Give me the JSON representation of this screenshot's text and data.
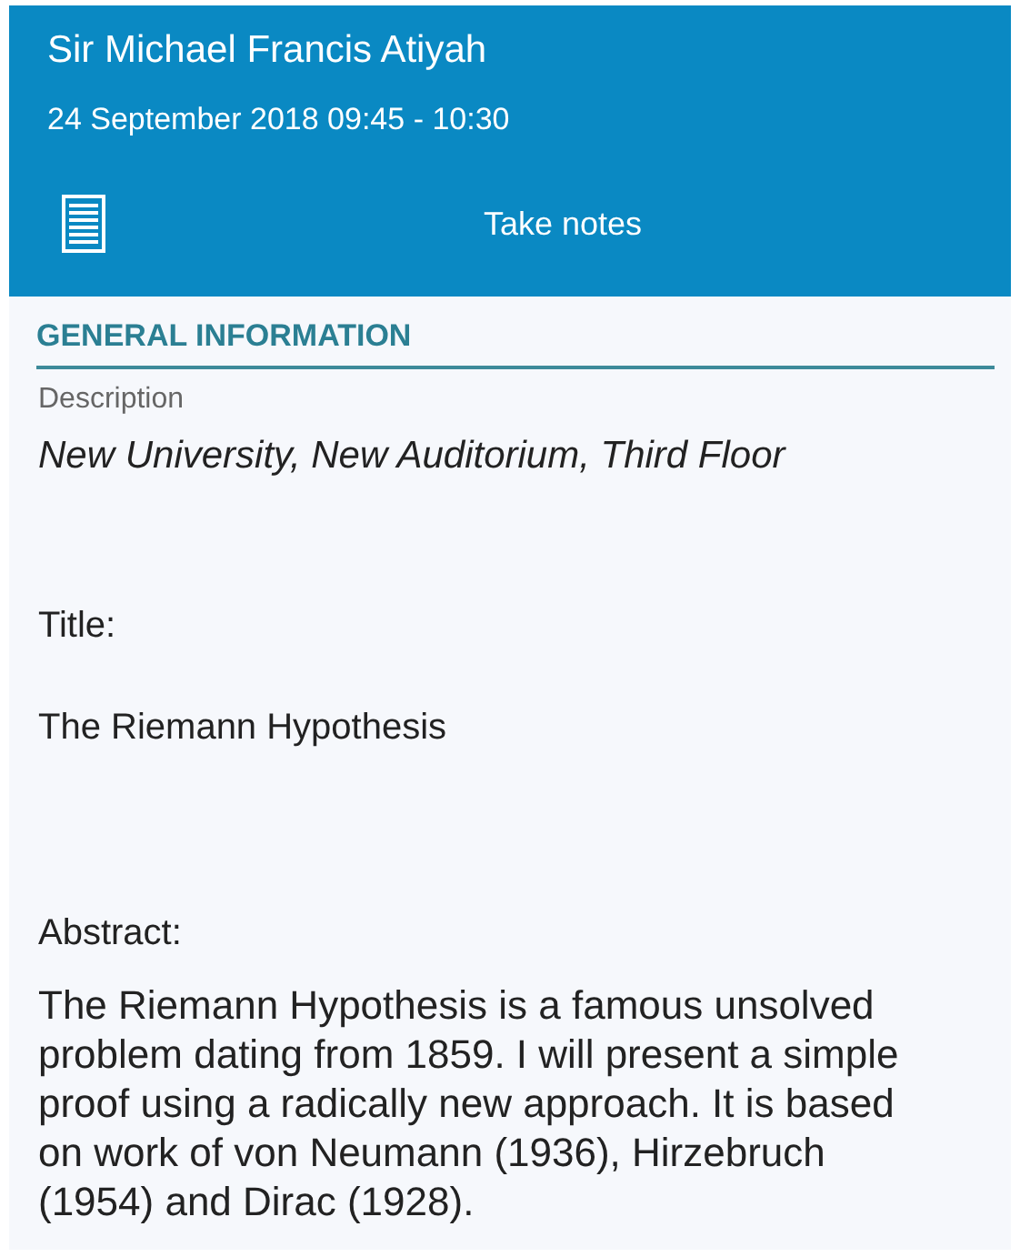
{
  "header": {
    "title": "Sir Michael Francis Atiyah",
    "datetime": "24 September 2018 09:45 - 10:30",
    "action": "Take notes"
  },
  "section": {
    "heading": "GENERAL INFORMATION",
    "fields": [
      {
        "kind": "caption",
        "text": "Description"
      },
      {
        "kind": "value",
        "text": "New University, New Auditorium, Third Floor"
      },
      {
        "kind": "label",
        "text": "Title:"
      },
      {
        "kind": "text",
        "text": "The Riemann Hypothesis"
      },
      {
        "kind": "label",
        "text": "Abstract:"
      },
      {
        "kind": "paragraph",
        "text": "The Riemann Hypothesis is a famous unsolved problem dating from 1859. I will present a simple proof using a radically new approach. It is based on work of von Neumann (1936), Hirzebruch (1954) and Dirac (1928)."
      }
    ]
  }
}
